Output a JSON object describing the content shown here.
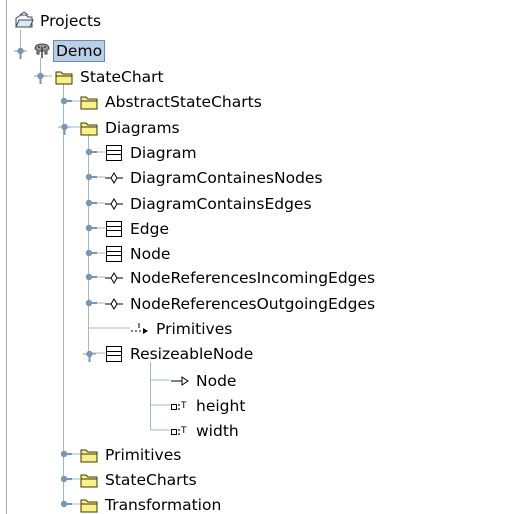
{
  "colors": {
    "line": "#a6b5c6",
    "handle": "#7b96b3",
    "folder_fill": "#f9ef8b",
    "folder_stroke": "#3a3a00",
    "selection": "#b8cfe5"
  },
  "tree": {
    "root": {
      "label": "Projects",
      "icon": "projects-folder-icon"
    },
    "demo": {
      "label": "Demo",
      "icon": "elephant-icon"
    },
    "statechart": {
      "label": "StateChart",
      "icon": "folder-icon"
    },
    "abstract_statecharts": {
      "label": "AbstractStateCharts",
      "icon": "folder-icon"
    },
    "diagrams": {
      "label": "Diagrams",
      "icon": "folder-icon"
    },
    "diagram": {
      "label": "Diagram",
      "icon": "class-icon"
    },
    "diagram_containes_nodes": {
      "label": "DiagramContainesNodes",
      "icon": "association-icon"
    },
    "diagram_contains_edges": {
      "label": "DiagramContainsEdges",
      "icon": "association-icon"
    },
    "edge": {
      "label": "Edge",
      "icon": "class-icon"
    },
    "node": {
      "label": "Node",
      "icon": "class-icon"
    },
    "node_references_incoming_edges": {
      "label": "NodeReferencesIncomingEdges",
      "icon": "association-icon"
    },
    "node_references_outgoing_edges": {
      "label": "NodeReferencesOutgoingEdges",
      "icon": "association-icon"
    },
    "primitives_import": {
      "label": "Primitives",
      "icon": "import-arrow-icon"
    },
    "resizeable_node": {
      "label": "ResizeableNode",
      "icon": "class-icon"
    },
    "rn_node": {
      "label": "Node",
      "icon": "generalization-arrow-icon"
    },
    "rn_height": {
      "label": "height",
      "icon": "attribute-icon"
    },
    "rn_width": {
      "label": "width",
      "icon": "attribute-icon"
    },
    "primitives_folder": {
      "label": "Primitives",
      "icon": "folder-icon"
    },
    "statecharts_folder": {
      "label": "StateCharts",
      "icon": "folder-icon"
    },
    "transformation_folder": {
      "label": "Transformation",
      "icon": "folder-icon"
    }
  }
}
